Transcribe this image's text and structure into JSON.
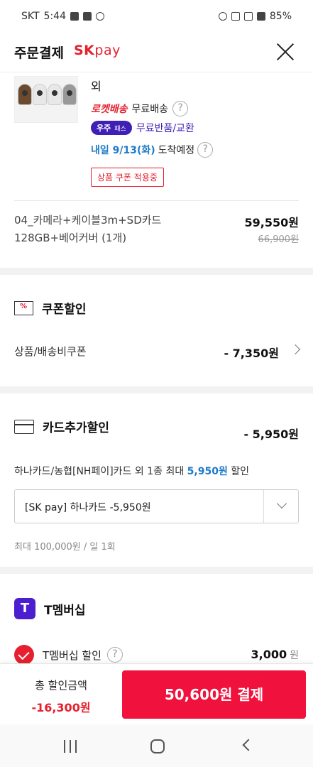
{
  "status": {
    "carrier": "SKT",
    "time": "5:44",
    "battery": "85%"
  },
  "header": {
    "title": "주문결제",
    "logo_sk": "SK",
    "logo_pay": "pay"
  },
  "product": {
    "more_label": "외",
    "rocket_label": "로켓배송",
    "free_shipping": "무료배송",
    "woju_label": "우주",
    "woju_small": "패스",
    "free_return": "무료반품/교환",
    "arrive_date": "내일 9/13(화)",
    "arrive_suffix": "도착예정",
    "coupon_tag": "상품 쿠폰 적용중",
    "option": "04_카메라+케이블3m+SD카드128GB+베어커버 (1개)",
    "price": "59,550원",
    "old_price": "66,900원"
  },
  "coupon": {
    "title": "쿠폰할인",
    "row_label": "상품/배송비쿠폰",
    "row_value": "- 7,350원"
  },
  "card": {
    "title": "카드추가할인",
    "discount": "- 5,950원",
    "desc_before": "하나카드/농협[NH페이]카드 외 1종 최대 ",
    "desc_highlight": "5,950원",
    "desc_after": " 할인",
    "selected": "[SK pay] 하나카드 -5,950원",
    "limit": "최대 100,000원 / 일 1회"
  },
  "tmembership": {
    "title": "T멤버십",
    "icon_letter": "T",
    "row_label": "T멤버십 할인",
    "row_value": "3,000",
    "won": "원"
  },
  "bottom": {
    "total_label": "총 할인금액",
    "total_value": "-16,300원",
    "pay_button": "50,600원 결제"
  },
  "colors": {
    "accent": "#f0113c",
    "brand_red": "#e6202e",
    "highlight_blue": "#1e7bc8",
    "woju_purple": "#3f1fb5"
  }
}
